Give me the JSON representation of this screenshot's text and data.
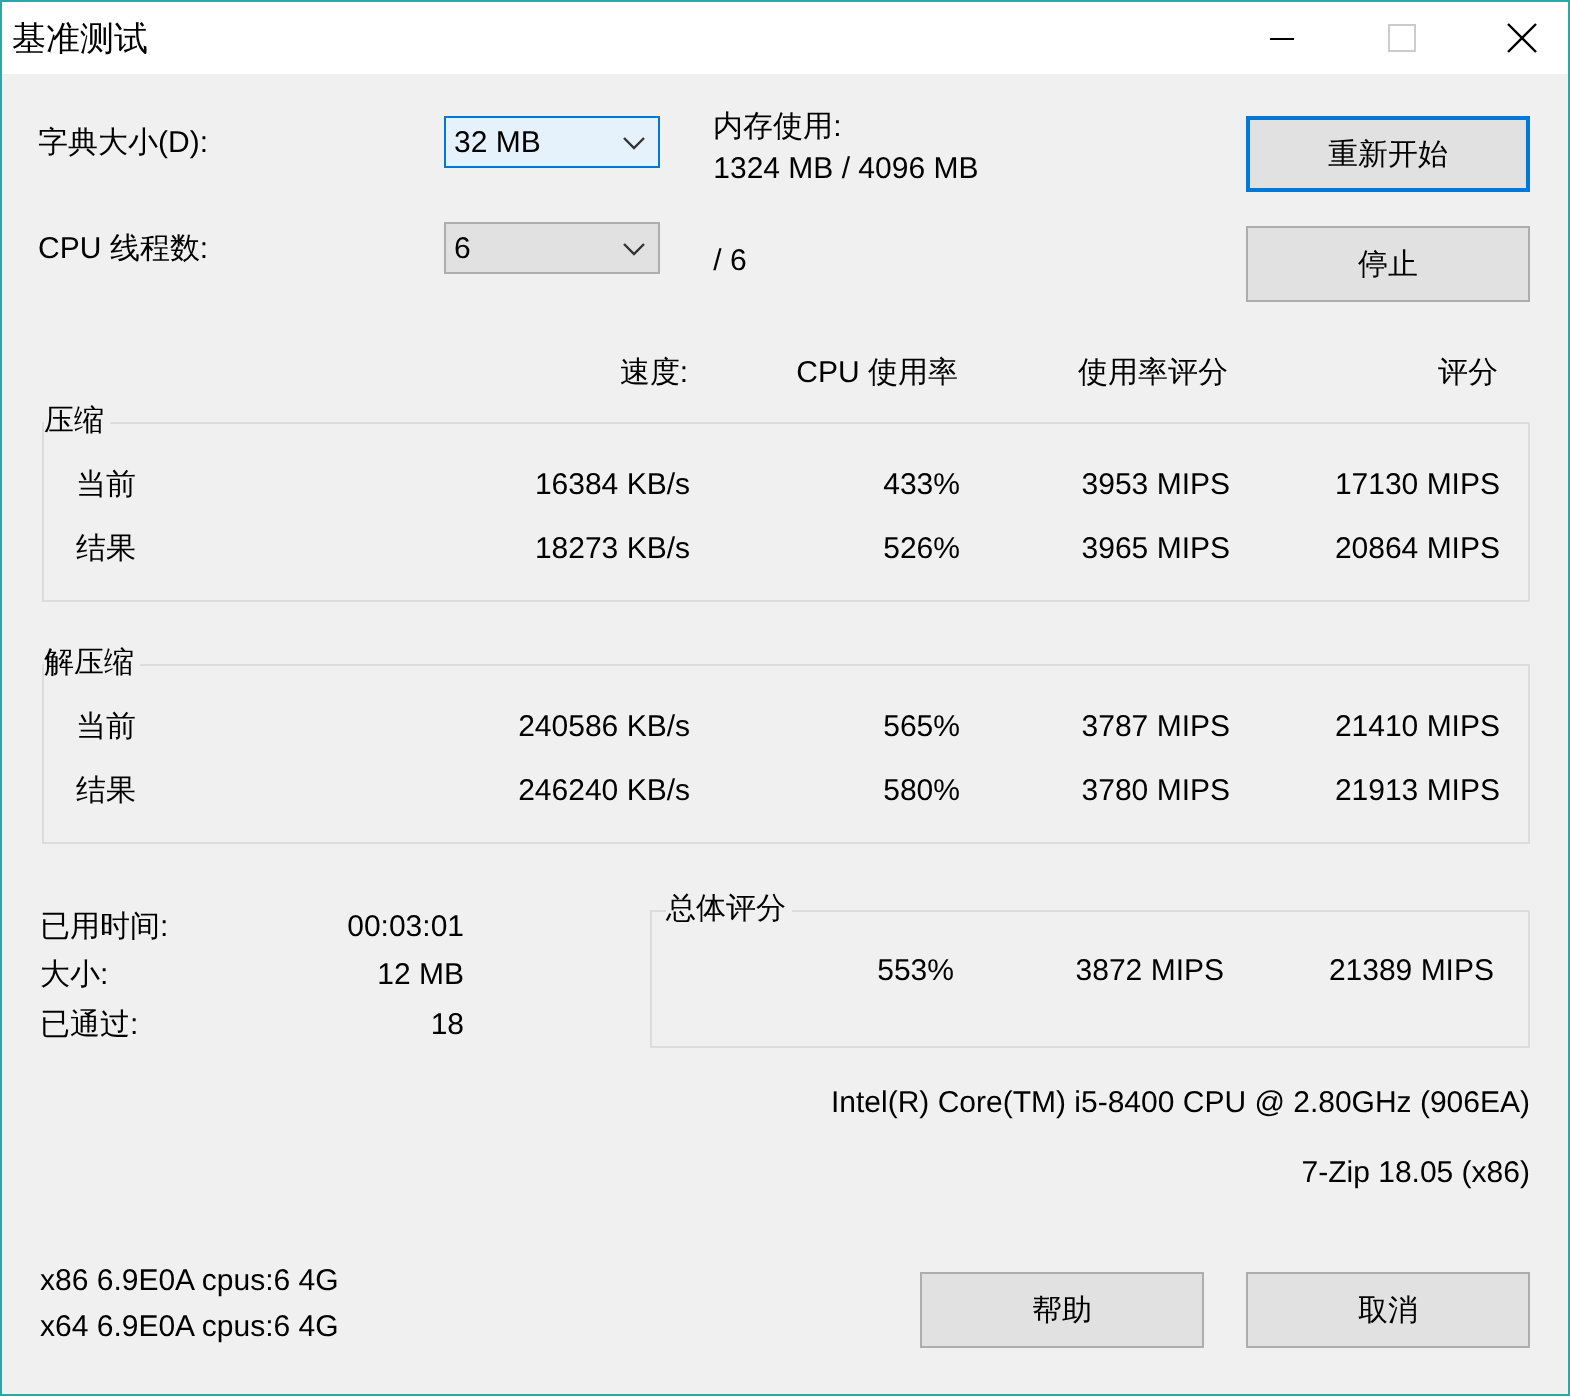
{
  "window": {
    "title": "基准测试"
  },
  "settings": [
    {
      "label": "字典大小(D):",
      "value": "32 MB",
      "focused": true
    },
    {
      "label": "CPU 线程数:",
      "value": "6",
      "focused": false
    }
  ],
  "memory": {
    "label": "内存使用:",
    "value": "1324 MB / 4096 MB"
  },
  "threads_total": "/ 6",
  "top_buttons": [
    {
      "label": "重新开始",
      "default": true
    },
    {
      "label": "停止",
      "default": false
    }
  ],
  "columns": [
    "速度:",
    "CPU 使用率",
    "使用率评分",
    "评分"
  ],
  "groups": [
    {
      "title": "压缩",
      "rows": [
        {
          "label": "当前",
          "cells": [
            "16384 KB/s",
            "433%",
            "3953 MIPS",
            "17130 MIPS"
          ]
        },
        {
          "label": "结果",
          "cells": [
            "18273 KB/s",
            "526%",
            "3965 MIPS",
            "20864 MIPS"
          ]
        }
      ]
    },
    {
      "title": "解压缩",
      "rows": [
        {
          "label": "当前",
          "cells": [
            "240586 KB/s",
            "565%",
            "3787 MIPS",
            "21410 MIPS"
          ]
        },
        {
          "label": "结果",
          "cells": [
            "246240 KB/s",
            "580%",
            "3780 MIPS",
            "21913 MIPS"
          ]
        }
      ]
    }
  ],
  "stats": [
    {
      "label": "已用时间:",
      "value": "00:03:01"
    },
    {
      "label": "大小:",
      "value": "12 MB"
    },
    {
      "label": "已通过:",
      "value": "18"
    }
  ],
  "total": {
    "title": "总体评分",
    "cells": [
      "553%",
      "3872 MIPS",
      "21389 MIPS"
    ]
  },
  "cpu_info": "Intel(R) Core(TM) i5-8400 CPU @ 2.80GHz (906EA)",
  "version": "7-Zip 18.05 (x86)",
  "arch_lines": [
    "x86 6.9E0A cpus:6 4G",
    "x64 6.9E0A cpus:6 4G"
  ],
  "bottom_buttons": [
    "帮助",
    "取消"
  ]
}
